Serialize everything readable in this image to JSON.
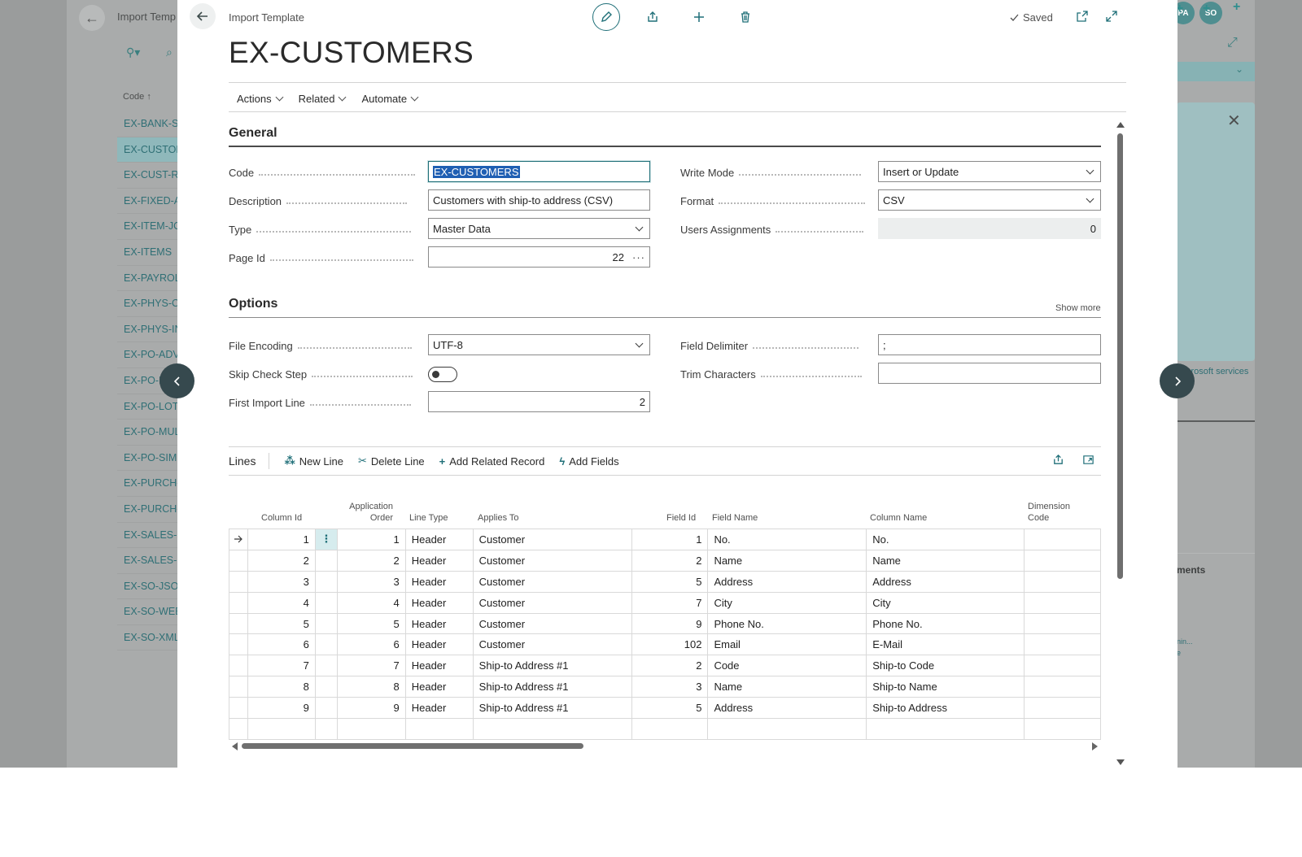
{
  "background": {
    "breadcrumb": "Import Temp",
    "code_header": "Code ↑",
    "codes": [
      "EX-BANK-ST",
      "EX-CUSTOM",
      "EX-CUST-RE",
      "EX-FIXED-A",
      "EX-ITEM-JO",
      "EX-ITEMS",
      "EX-PAYROLL",
      "EX-PHYS-CO",
      "EX-PHYS-IN",
      "EX-PO-ADV",
      "EX-PO-R",
      "EX-PO-LOTS",
      "EX-PO-MUL",
      "EX-PO-SIM",
      "EX-PURCH-",
      "EX-PURCH-",
      "EX-SALES-I",
      "EX-SALES-P",
      "EX-SO-JSON",
      "EX-SO-WEB",
      "EX-SO-XML"
    ],
    "selected_code_index": 1,
    "avatars": [
      "PA",
      "SO"
    ],
    "ms_services_text": "crosoft services",
    "ments_text": "ments",
    "minor_text_1": "nin...",
    "minor_text_2": "e"
  },
  "header": {
    "breadcrumb": "Import Template",
    "title": "EX-CUSTOMERS",
    "saved_label": "Saved"
  },
  "actions": [
    {
      "label": "Actions"
    },
    {
      "label": "Related"
    },
    {
      "label": "Automate"
    }
  ],
  "general": {
    "title": "General",
    "code_label": "Code",
    "code_value": "EX-CUSTOMERS",
    "description_label": "Description",
    "description_value": "Customers with ship-to address (CSV)",
    "type_label": "Type",
    "type_value": "Master Data",
    "page_id_label": "Page Id",
    "page_id_value": "22",
    "write_mode_label": "Write Mode",
    "write_mode_value": "Insert or Update",
    "format_label": "Format",
    "format_value": "CSV",
    "users_assignments_label": "Users Assignments",
    "users_assignments_value": "0"
  },
  "options": {
    "title": "Options",
    "show_more": "Show more",
    "file_encoding_label": "File Encoding",
    "file_encoding_value": "UTF-8",
    "skip_check_step_label": "Skip Check Step",
    "skip_check_step_value": false,
    "first_import_line_label": "First Import Line",
    "first_import_line_value": "2",
    "field_delimiter_label": "Field Delimiter",
    "field_delimiter_value": ";",
    "trim_characters_label": "Trim Characters",
    "trim_characters_value": ""
  },
  "lines": {
    "title": "Lines",
    "new_line": "New Line",
    "delete_line": "Delete Line",
    "add_related_record": "Add Related Record",
    "add_fields": "Add Fields",
    "columns": {
      "column_id": "Column Id",
      "application_order_1": "Application",
      "application_order_2": "Order",
      "line_type": "Line Type",
      "applies_to": "Applies To",
      "field_id": "Field Id",
      "field_name": "Field Name",
      "column_name": "Column Name",
      "dimension_code_1": "Dimension",
      "dimension_code_2": "Code"
    },
    "rows": [
      {
        "column_id": "1",
        "order": "1",
        "line_type": "Header",
        "applies_to": "Customer",
        "field_id": "1",
        "field_name": "No.",
        "column_name": "No.",
        "dimension_code": ""
      },
      {
        "column_id": "2",
        "order": "2",
        "line_type": "Header",
        "applies_to": "Customer",
        "field_id": "2",
        "field_name": "Name",
        "column_name": "Name",
        "dimension_code": ""
      },
      {
        "column_id": "3",
        "order": "3",
        "line_type": "Header",
        "applies_to": "Customer",
        "field_id": "5",
        "field_name": "Address",
        "column_name": "Address",
        "dimension_code": ""
      },
      {
        "column_id": "4",
        "order": "4",
        "line_type": "Header",
        "applies_to": "Customer",
        "field_id": "7",
        "field_name": "City",
        "column_name": "City",
        "dimension_code": ""
      },
      {
        "column_id": "5",
        "order": "5",
        "line_type": "Header",
        "applies_to": "Customer",
        "field_id": "9",
        "field_name": "Phone No.",
        "column_name": "Phone No.",
        "dimension_code": ""
      },
      {
        "column_id": "6",
        "order": "6",
        "line_type": "Header",
        "applies_to": "Customer",
        "field_id": "102",
        "field_name": "Email",
        "column_name": "E-Mail",
        "dimension_code": ""
      },
      {
        "column_id": "7",
        "order": "7",
        "line_type": "Header",
        "applies_to": "Ship-to Address #1",
        "field_id": "2",
        "field_name": "Code",
        "column_name": "Ship-to Code",
        "dimension_code": ""
      },
      {
        "column_id": "8",
        "order": "8",
        "line_type": "Header",
        "applies_to": "Ship-to Address #1",
        "field_id": "3",
        "field_name": "Name",
        "column_name": "Ship-to Name",
        "dimension_code": ""
      },
      {
        "column_id": "9",
        "order": "9",
        "line_type": "Header",
        "applies_to": "Ship-to Address #1",
        "field_id": "5",
        "field_name": "Address",
        "column_name": "Ship-to Address",
        "dimension_code": ""
      },
      {
        "column_id": "",
        "order": "",
        "line_type": "",
        "applies_to": "",
        "field_id": "",
        "field_name": "",
        "column_name": "",
        "dimension_code": ""
      }
    ]
  },
  "icons": {
    "back": "back-arrow-icon",
    "edit": "pencil-icon",
    "share": "share-icon",
    "new": "plus-icon",
    "delete": "trash-icon",
    "open_new_window": "open-new-window-icon",
    "expand": "expand-icon"
  },
  "colors": {
    "accent": "#1f6f78",
    "selection": "#1f5fb3",
    "nav_circle": "#36494e"
  }
}
